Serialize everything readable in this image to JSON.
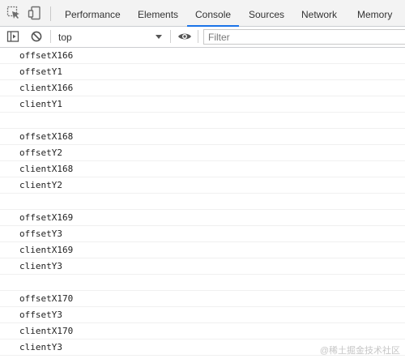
{
  "tabs": [
    {
      "label": "Performance",
      "active": false
    },
    {
      "label": "Elements",
      "active": false
    },
    {
      "label": "Console",
      "active": true
    },
    {
      "label": "Sources",
      "active": false
    },
    {
      "label": "Network",
      "active": false
    },
    {
      "label": "Memory",
      "active": false
    }
  ],
  "toolbar": {
    "context": "top",
    "filter_placeholder": "Filter"
  },
  "messages": [
    "offsetX166",
    "offsetY1",
    "clientX166",
    "clientY1",
    "",
    "offsetX168",
    "offsetY2",
    "clientX168",
    "clientY2",
    "",
    "offsetX169",
    "offsetY3",
    "clientX169",
    "clientY3",
    "",
    "offsetX170",
    "offsetY3",
    "clientX170",
    "clientY3"
  ],
  "watermark": "@稀土掘金技术社区",
  "colors": {
    "accent": "#1a73e8",
    "tabbar_bg": "#f3f3f3"
  },
  "icons": [
    "inspect-element-icon",
    "device-toolbar-icon",
    "sidebar-toggle-icon",
    "clear-console-icon",
    "eye-icon"
  ]
}
